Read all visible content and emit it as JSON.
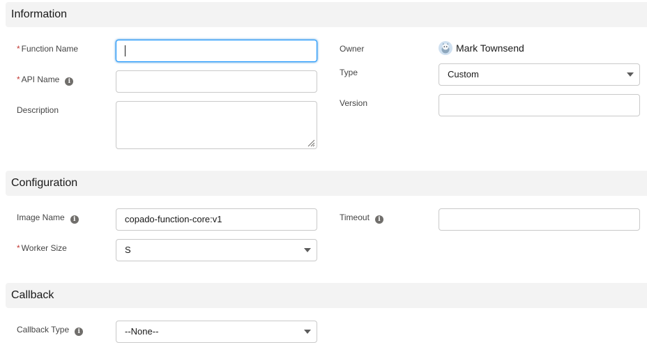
{
  "sections": {
    "information": "Information",
    "configuration": "Configuration",
    "callback": "Callback"
  },
  "fields": {
    "function_name": {
      "label": "Function Name",
      "value": "",
      "required": "*"
    },
    "api_name": {
      "label": "API Name",
      "value": "",
      "required": "*"
    },
    "description": {
      "label": "Description",
      "value": ""
    },
    "owner": {
      "label": "Owner",
      "value": "Mark Townsend"
    },
    "type": {
      "label": "Type",
      "value": "Custom"
    },
    "version": {
      "label": "Version",
      "value": ""
    },
    "image_name": {
      "label": "Image Name",
      "value": "copado-function-core:v1"
    },
    "timeout": {
      "label": "Timeout",
      "value": ""
    },
    "worker_size": {
      "label": "Worker Size",
      "value": "S",
      "required": "*"
    },
    "callback_type": {
      "label": "Callback Type",
      "value": "--None--"
    }
  },
  "icons": {
    "info": "i",
    "info_icon_name": "info-icon",
    "chevron_icon_name": "chevron-down-icon",
    "avatar_icon_name": "user-avatar-icon"
  },
  "colors": {
    "required": "#c23934",
    "focus": "#1b96ff",
    "section_bg": "#f3f3f3"
  }
}
